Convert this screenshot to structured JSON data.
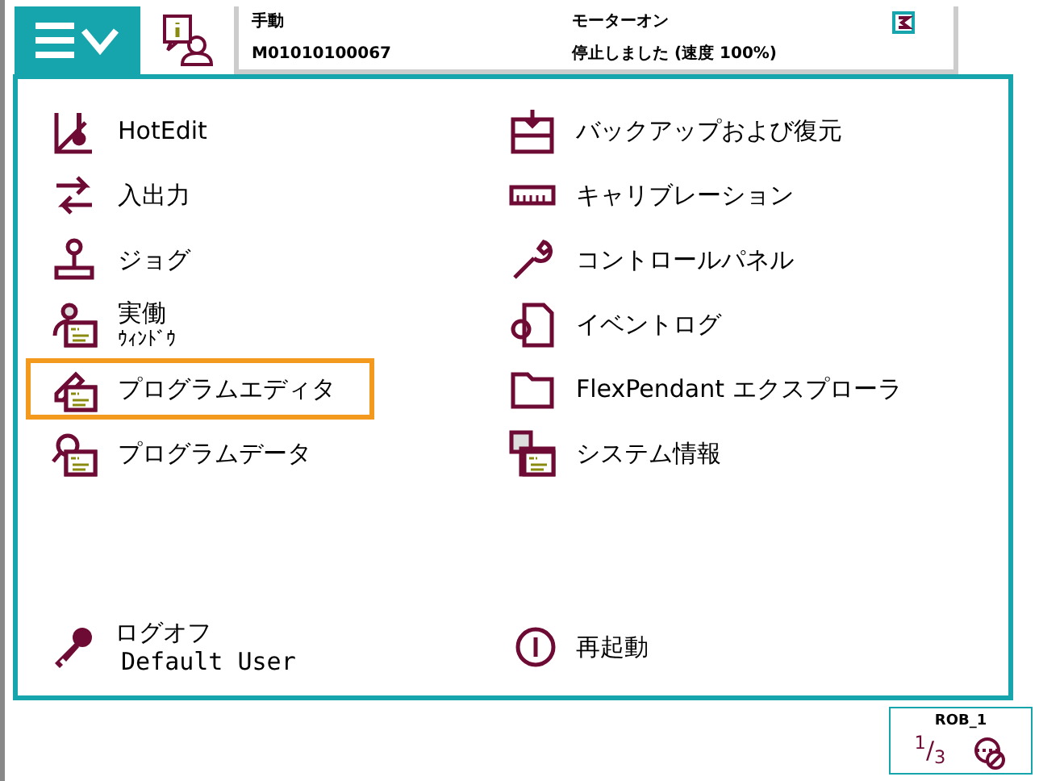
{
  "status": {
    "mode": "手動",
    "system": "M01010100067",
    "motors": "モーターオン",
    "state": "停止しました (速度 100%)"
  },
  "menu": {
    "left": [
      {
        "lines": [
          "HotEdit"
        ],
        "selected": false
      },
      {
        "lines": [
          "入出力"
        ],
        "selected": false
      },
      {
        "lines": [
          "ジョグ"
        ],
        "selected": false
      },
      {
        "lines": [
          "実働",
          "ｳｨﾝﾄﾞｳ"
        ],
        "selected": false
      },
      {
        "lines": [
          "プログラムエディタ"
        ],
        "selected": true
      },
      {
        "lines": [
          "プログラムデータ"
        ],
        "selected": false
      }
    ],
    "right": [
      {
        "lines": [
          "バックアップおよび復元"
        ],
        "selected": false
      },
      {
        "lines": [
          "キャリブレーション"
        ],
        "selected": false
      },
      {
        "lines": [
          "コントロールパネル"
        ],
        "selected": false
      },
      {
        "lines": [
          "イベントログ"
        ],
        "selected": false
      },
      {
        "lines": [
          "FlexPendant エクスプローラ"
        ],
        "selected": false
      },
      {
        "lines": [
          "システム情報"
        ],
        "selected": false
      }
    ]
  },
  "logoff": {
    "label": "ログオフ",
    "user": "Default User"
  },
  "restart": {
    "label": "再起動"
  },
  "quickset": {
    "unit": "ROB_1",
    "increment": "$^{1}$/$_{3}$"
  }
}
